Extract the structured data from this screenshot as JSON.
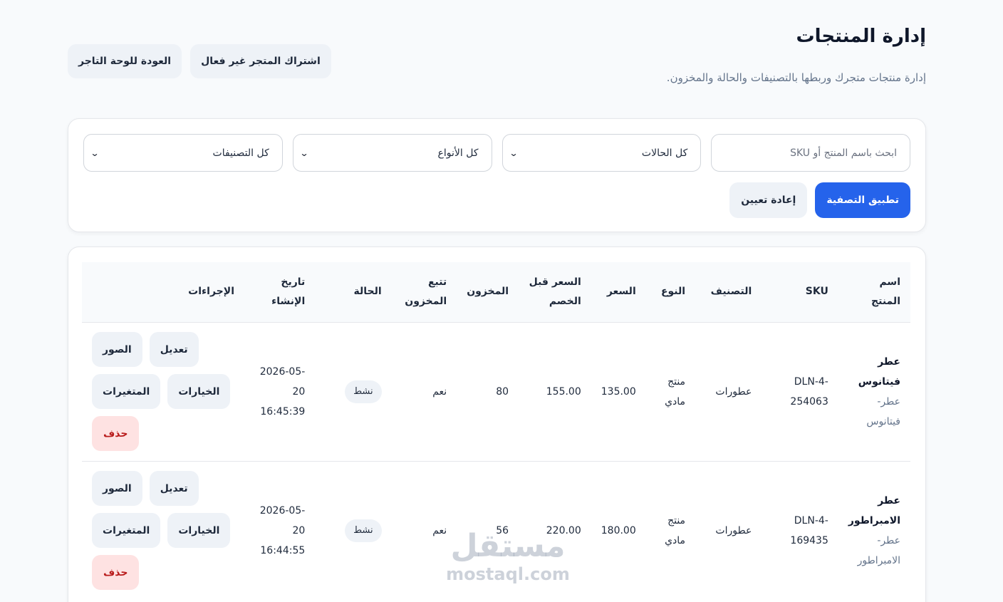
{
  "header": {
    "title": "إدارة المنتجات",
    "subtitle": "إدارة منتجات متجرك وربطها بالتصنيفات والحالة والمخزون.",
    "back_button": "العودة للوحة التاجر",
    "subscription_button": "اشتراك المتجر غير فعال"
  },
  "filters": {
    "search_placeholder": "ابحث باسم المنتج أو SKU",
    "status_value": "كل الحالات",
    "type_value": "كل الأنواع",
    "category_value": "كل التصنيفات",
    "apply_label": "تطبيق التصفية",
    "reset_label": "إعادة تعيين"
  },
  "table": {
    "headers": {
      "name": "اسم المنتج",
      "sku": "SKU",
      "category": "التصنيف",
      "type": "النوع",
      "price": "السعر",
      "compare_price": "السعر قبل الخصم",
      "stock": "المخزون",
      "track_stock": "تتبع المخزون",
      "status": "الحالة",
      "created_at": "تاريخ الإنشاء",
      "actions": "الإجراءات"
    },
    "rows": [
      {
        "name": "عطر فيتانوس",
        "slug": "عطر-فيتانوس",
        "sku": "DLN-4-254063",
        "category": "عطورات",
        "type": "منتج مادي",
        "price": "135.00",
        "compare_price": "155.00",
        "stock": "80",
        "track_stock": "نعم",
        "status": "نشط",
        "created_date": "2026-05-20",
        "created_time": "16:45:39"
      },
      {
        "name": "عطر الامبراطور",
        "slug": "عطر-الامبراطور",
        "sku": "DLN-4-169435",
        "category": "عطورات",
        "type": "منتج مادي",
        "price": "180.00",
        "compare_price": "220.00",
        "stock": "56",
        "track_stock": "نعم",
        "status": "نشط",
        "created_date": "2026-05-20",
        "created_time": "16:44:55"
      }
    ],
    "actions": {
      "edit": "تعديل",
      "images": "الصور",
      "options": "الخيارات",
      "variants": "المتغيرات",
      "delete": "حذف"
    }
  },
  "watermark": {
    "arabic": "مستقل",
    "english": "mostaql.com"
  },
  "colors": {
    "primary": "#2563eb",
    "danger_bg": "#fee2e2",
    "danger_text": "#b91c1c",
    "soft_bg": "#eef2f7",
    "page_bg": "#f8fafc"
  },
  "icons": {
    "select_chevron": "chevron-down-icon"
  }
}
